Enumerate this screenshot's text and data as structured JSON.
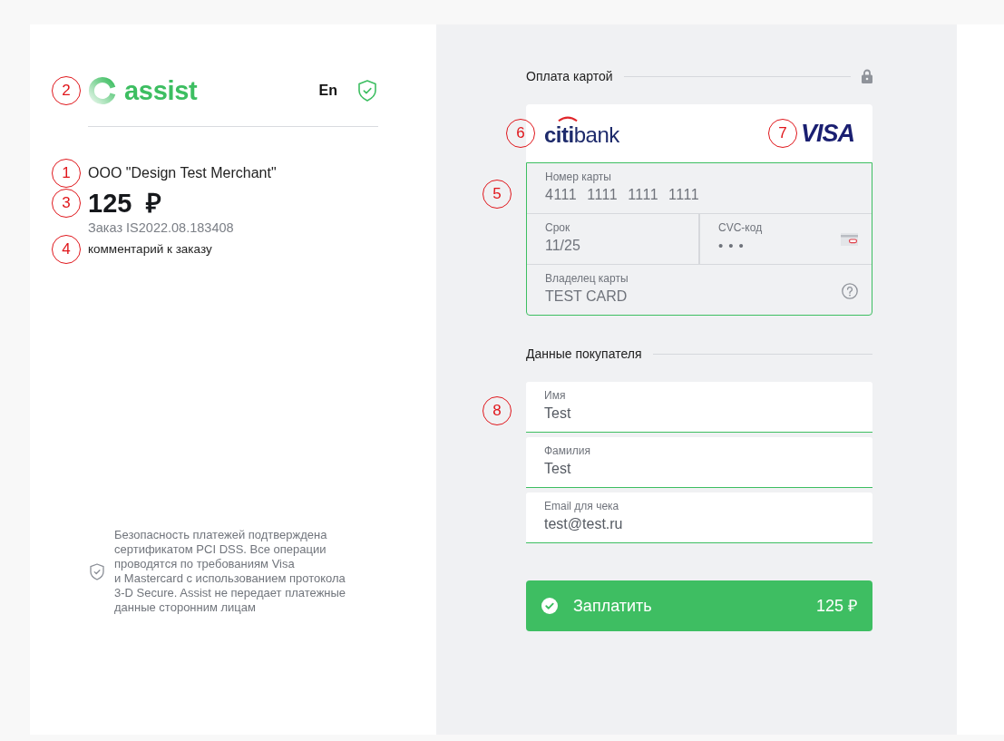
{
  "header": {
    "callout": "2",
    "logo_text": "assist",
    "language": "En"
  },
  "order": {
    "merchant": {
      "callout": "1",
      "text": "ООО \"Design Test Merchant\""
    },
    "amount": {
      "callout": "3",
      "text": "125 ₽"
    },
    "number": "Заказ IS2022.08.183408",
    "comment": {
      "callout": "4",
      "text": "комментарий к заказу"
    }
  },
  "security_note": "Безопасность платежей подтверждена\nсертификатом PCI DSS. Все операции\nпроводятся по требованиям Visa\nи Mastercard с использованием протокола\n3-D Secure. Assist не передает платежные\nданные сторонним лицам",
  "card_payment": {
    "title": "Оплата картой",
    "bank": {
      "callout": "6",
      "text": "**citi**bank"
    },
    "network": {
      "callout": "7",
      "text": "VISA"
    },
    "form": {
      "callout": "5",
      "valid": true,
      "fields": [
        {
          "kind": "number",
          "label": "Номер карты",
          "value": "4111 1111 1111 1111"
        },
        {
          "kind": "expiry",
          "label": "Срок",
          "value": "11/25"
        },
        {
          "kind": "cvc",
          "label": "CVC-код",
          "value": "•••"
        },
        {
          "kind": "holder",
          "label": "Владелец карты",
          "value": "TEST CARD"
        }
      ]
    }
  },
  "buyer": {
    "title": "Данные покупателя",
    "callout": "8",
    "fields": [
      {
        "label": "Имя",
        "value": "Test",
        "valid": true
      },
      {
        "label": "Фамилия",
        "value": "Test",
        "valid": true
      },
      {
        "label": "Email для чека",
        "value": "test@test.ru",
        "valid": true
      }
    ]
  },
  "pay_button": {
    "label": "Заплатить",
    "amount": "125 ₽"
  }
}
